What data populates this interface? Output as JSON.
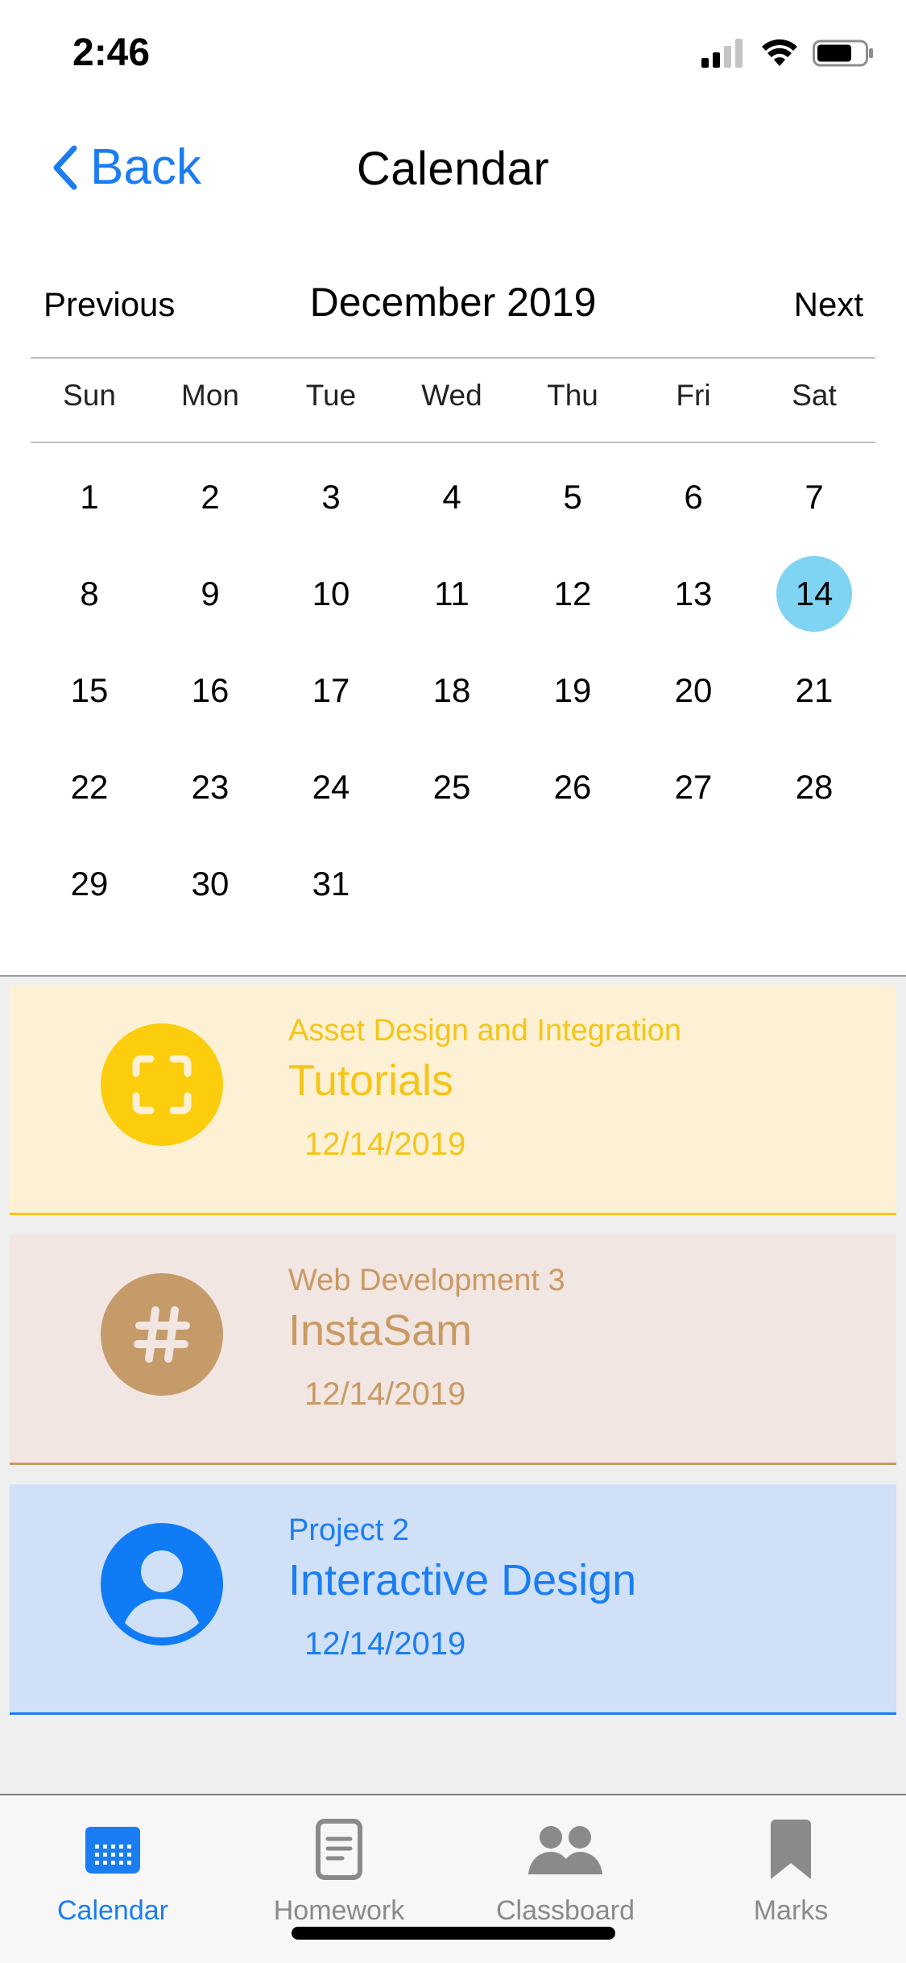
{
  "status": {
    "time": "2:46"
  },
  "nav": {
    "back_label": "Back",
    "title": "Calendar"
  },
  "calendar": {
    "previous_label": "Previous",
    "next_label": "Next",
    "month_label": "December 2019",
    "weekdays": [
      "Sun",
      "Mon",
      "Tue",
      "Wed",
      "Thu",
      "Fri",
      "Sat"
    ],
    "days": [
      "1",
      "2",
      "3",
      "4",
      "5",
      "6",
      "7",
      "8",
      "9",
      "10",
      "11",
      "12",
      "13",
      "14",
      "15",
      "16",
      "17",
      "18",
      "19",
      "20",
      "21",
      "22",
      "23",
      "24",
      "25",
      "26",
      "27",
      "28",
      "29",
      "30",
      "31"
    ],
    "selected_day": "14",
    "first_weekday_index": 0,
    "selected_color": "#7fd4f4"
  },
  "events": [
    {
      "course": "Asset Design and Integration",
      "title": "Tutorials",
      "date": "12/14/2019",
      "icon": "scan-icon",
      "bg": "#fcf1d4",
      "accent": "#f5c518",
      "icon_bg": "#fbcd0c"
    },
    {
      "course": "Web Development 3",
      "title": "InstaSam",
      "date": "12/14/2019",
      "icon": "hashtag-icon",
      "bg": "#f2e6e2",
      "accent": "#c99a64",
      "icon_bg": "#c59b6a"
    },
    {
      "course": "Project 2",
      "title": "Interactive Design",
      "date": "12/14/2019",
      "icon": "person-icon",
      "bg": "#cfe0f7",
      "accent": "#1a7df2",
      "icon_bg": "#0f7bf5"
    }
  ],
  "tabs": [
    {
      "label": "Calendar",
      "icon": "calendar-icon",
      "active": true
    },
    {
      "label": "Homework",
      "icon": "document-icon",
      "active": false
    },
    {
      "label": "Classboard",
      "icon": "people-icon",
      "active": false
    },
    {
      "label": "Marks",
      "icon": "bookmark-icon",
      "active": false
    }
  ],
  "colors": {
    "accent": "#1a7df2",
    "inactive_tab": "#8a8a8a"
  }
}
